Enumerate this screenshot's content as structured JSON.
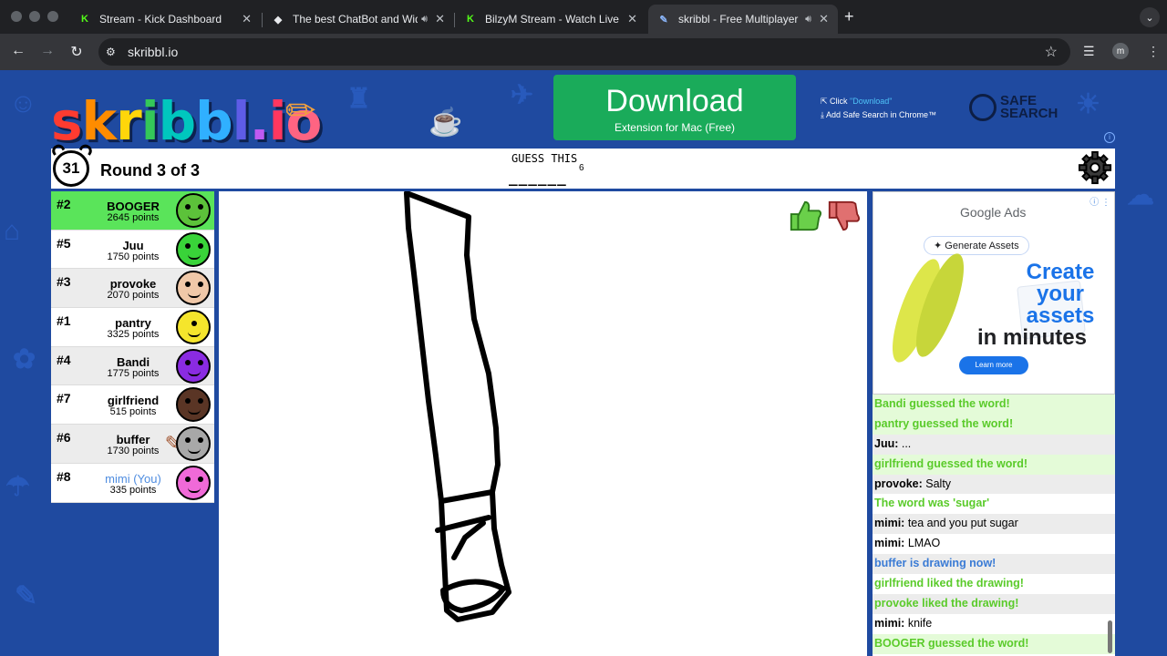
{
  "browser": {
    "tabs": [
      {
        "title": "Stream - Kick Dashboard",
        "favicon": "K"
      },
      {
        "title": "The best ChatBot and Wid",
        "favicon": "◆"
      },
      {
        "title": "BilzyM Stream - Watch Live o",
        "favicon": "K"
      },
      {
        "title": "skribbl - Free Multiplayer",
        "favicon": "✎"
      }
    ],
    "url": "skribbl.io",
    "profile_initial": "m"
  },
  "header": {
    "logo_text": "skribbl.io",
    "download_title": "Download",
    "download_subtitle": "Extension for Mac (Free)",
    "click_prefix": "Click ",
    "click_highlight": "\"Download\"",
    "add_text": "Add Safe Search in Chrome™",
    "safe_search_line1": "SAFE",
    "safe_search_line2": "SEARCH"
  },
  "game": {
    "timer": "31",
    "round": "Round 3 of 3",
    "guess_label": "GUESS THIS",
    "blanks": "______",
    "word_length": "6",
    "word_bubble": "knife"
  },
  "players": [
    {
      "rank": "#2",
      "name": "BOOGER",
      "points": "2645 points",
      "color": "#5cc23a"
    },
    {
      "rank": "#5",
      "name": "Juu",
      "points": "1750 points",
      "color": "#39d339"
    },
    {
      "rank": "#3",
      "name": "provoke",
      "points": "2070 points",
      "color": "#f0c8a8"
    },
    {
      "rank": "#1",
      "name": "pantry",
      "points": "3325 points",
      "color": "#f5e52c"
    },
    {
      "rank": "#4",
      "name": "Bandi",
      "points": "1775 points",
      "color": "#8a2be2"
    },
    {
      "rank": "#7",
      "name": "girlfriend",
      "points": "515 points",
      "color": "#5a3525"
    },
    {
      "rank": "#6",
      "name": "buffer",
      "points": "1730 points",
      "color": "#a8a8a8"
    },
    {
      "rank": "#8",
      "name": "mimi (You)",
      "points": "335 points",
      "color": "#f06ad8"
    }
  ],
  "ad": {
    "brand": "Google Ads",
    "pill": "✦ Generate Assets",
    "headline_1": "Create",
    "headline_2": "your",
    "headline_3": "assets",
    "headline_4": "in minutes",
    "cta": "Learn more"
  },
  "chat": [
    {
      "text": "Bandi guessed the word!"
    },
    {
      "text": "pantry guessed the word!"
    },
    {
      "name": "Juu:",
      "text": " ..."
    },
    {
      "text": "girlfriend guessed the word!"
    },
    {
      "name": "provoke:",
      "text": " Salty"
    },
    {
      "text": "The word was 'sugar'"
    },
    {
      "name": "mimi:",
      "text": " tea and you put sugar"
    },
    {
      "name": "mimi:",
      "text": " LMAO"
    },
    {
      "text": "buffer is drawing now!"
    },
    {
      "text": "girlfriend liked the drawing!"
    },
    {
      "text": "provoke liked the drawing!"
    },
    {
      "name": "mimi:",
      "text": " knife"
    },
    {
      "text": "BOOGER guessed the word!"
    }
  ]
}
